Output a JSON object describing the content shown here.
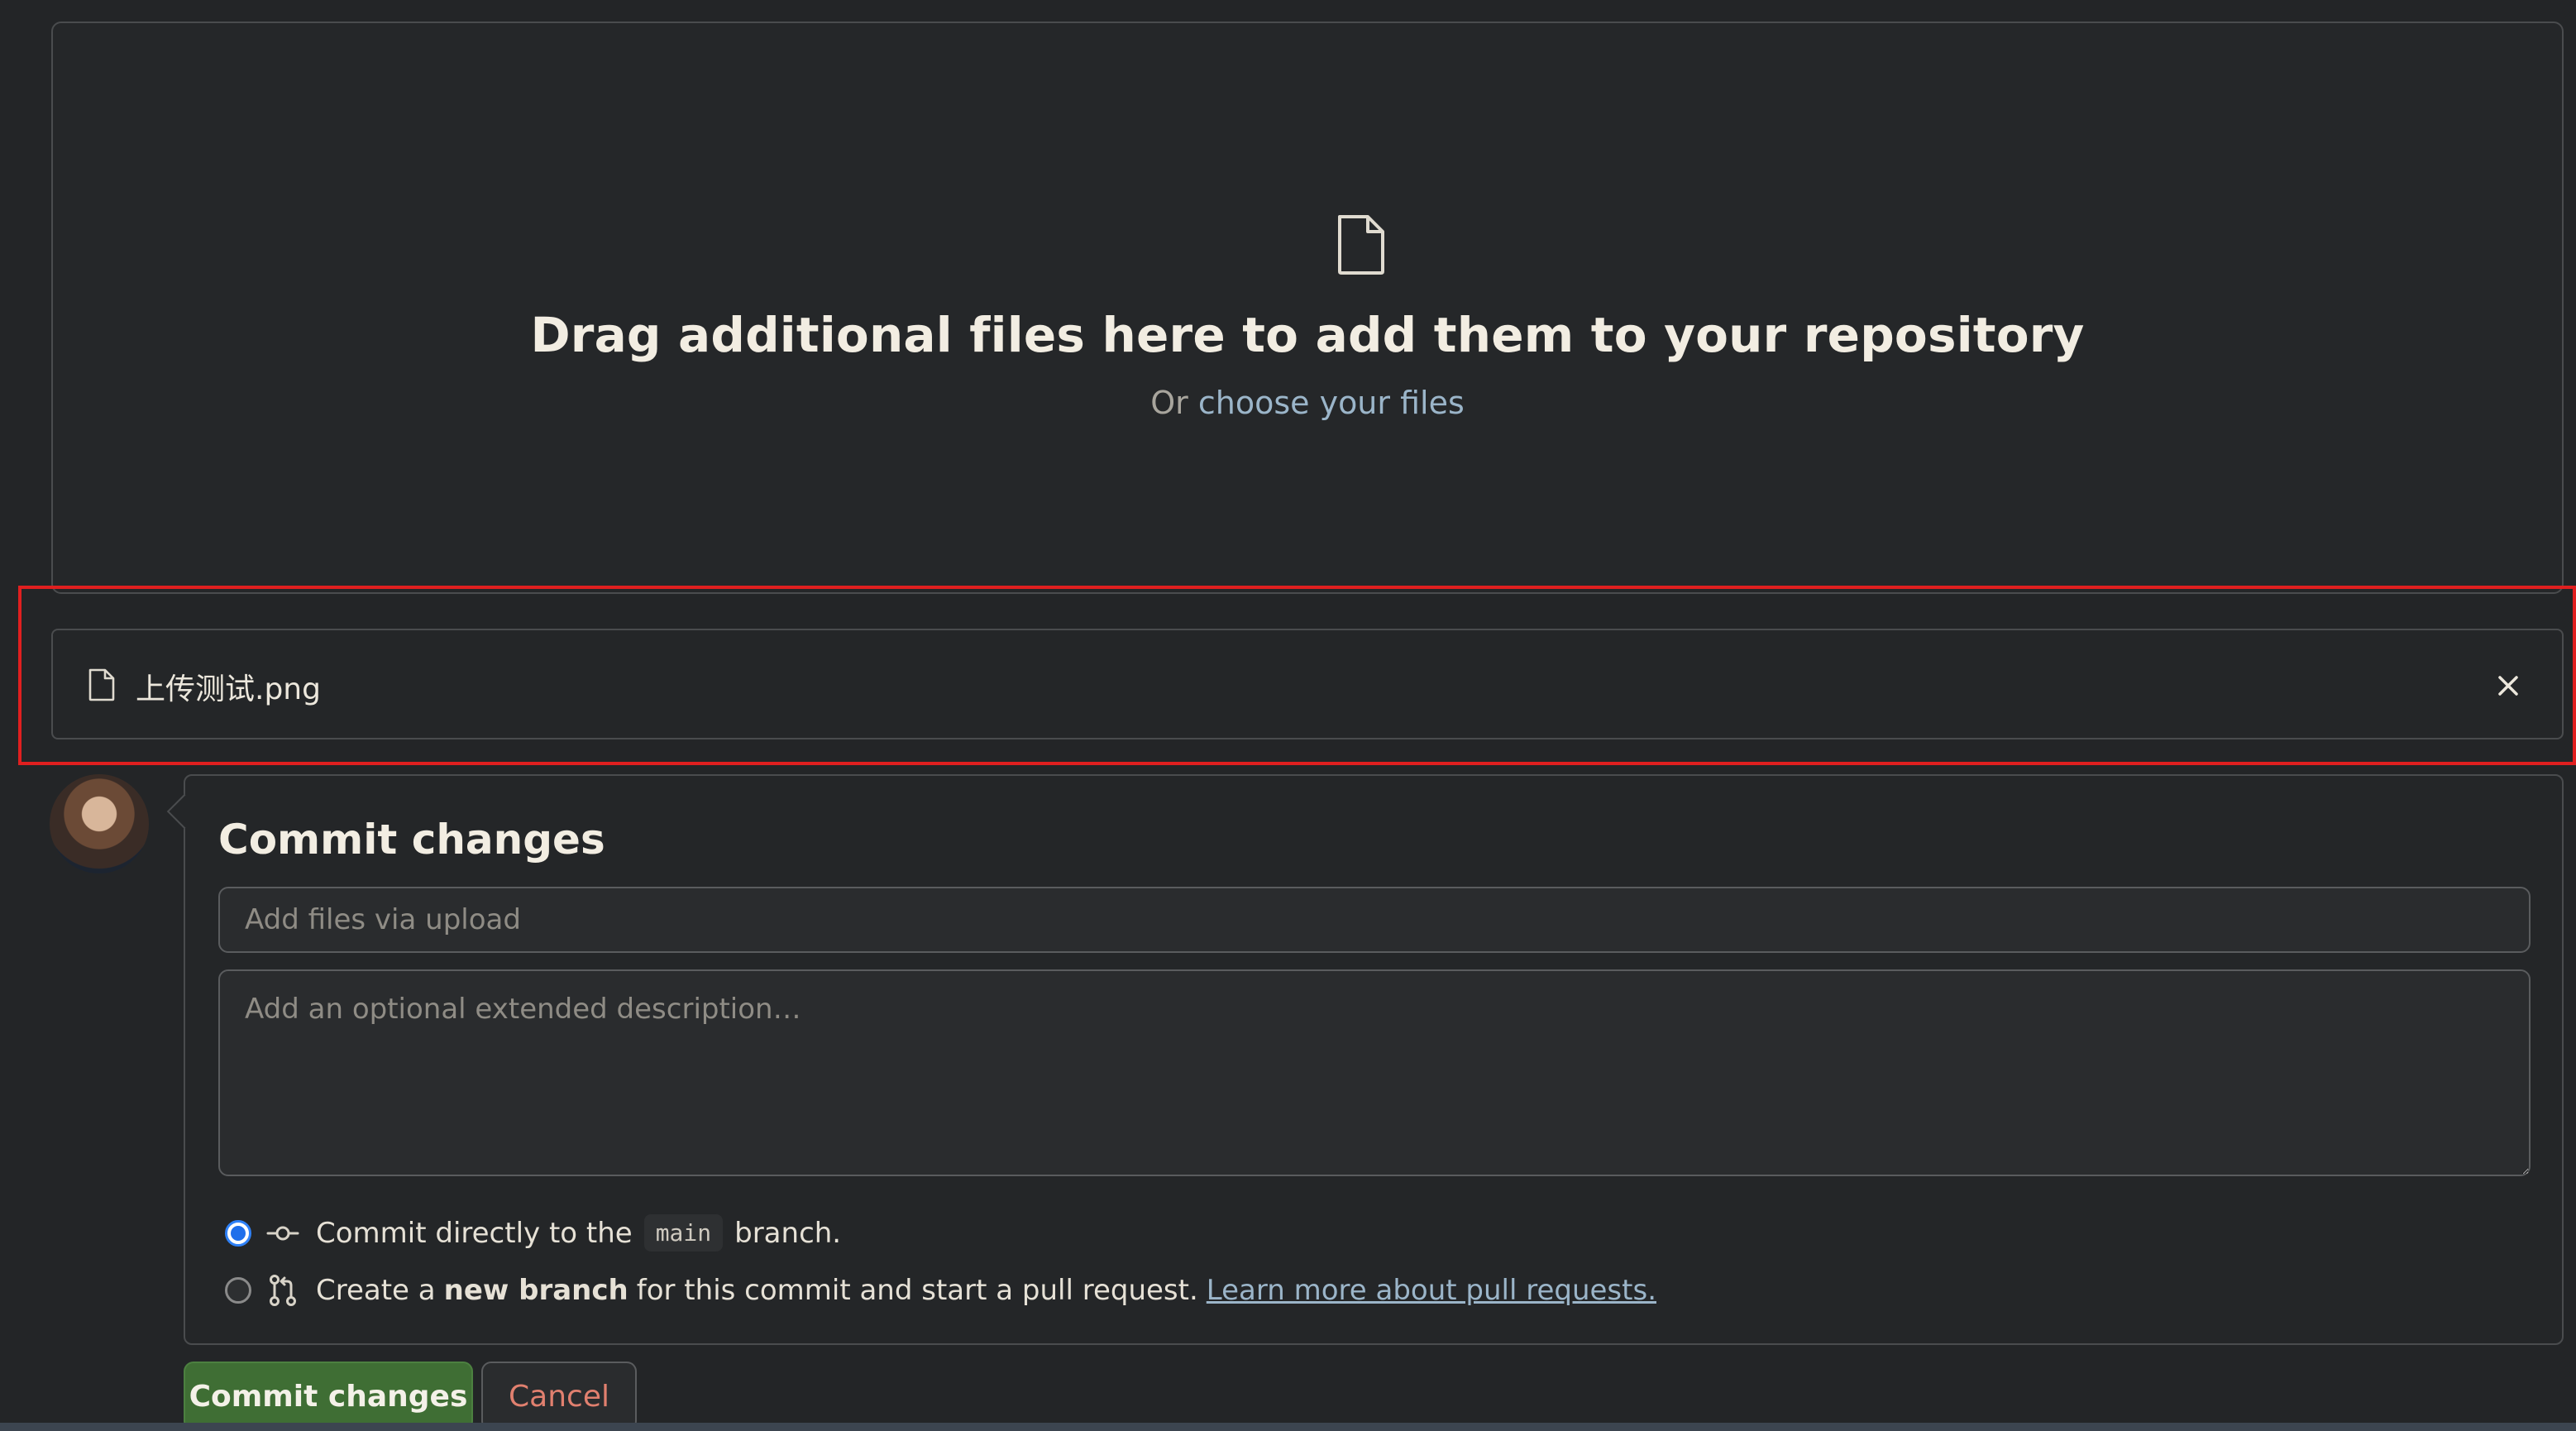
{
  "dropzone": {
    "title": "Drag additional files here to add them to your repository",
    "sub_prefix": "Or ",
    "choose_link": "choose your files",
    "icon": "file-icon"
  },
  "file": {
    "name": "上传测试.png",
    "icon": "file-icon",
    "remove_icon": "close-icon"
  },
  "commit": {
    "title": "Commit changes",
    "summary_placeholder": "Add files via upload",
    "description_placeholder": "Add an optional extended description…",
    "option_direct": {
      "prefix": "Commit directly to the",
      "branch": "main",
      "suffix": "branch.",
      "checked": true,
      "icon": "git-commit-icon"
    },
    "option_new_branch": {
      "prefix": "Create a",
      "bold": "new branch",
      "suffix": "for this commit and start a pull request.",
      "link": "Learn more about pull requests.",
      "checked": false,
      "icon": "git-pull-request-icon"
    }
  },
  "buttons": {
    "commit": "Commit changes",
    "cancel": "Cancel"
  },
  "colors": {
    "background": "#232527",
    "accent_link": "#9bb5c9",
    "commit_button": "#3f6e34",
    "cancel_text": "#e1806f",
    "highlight": "#e01f1f"
  }
}
